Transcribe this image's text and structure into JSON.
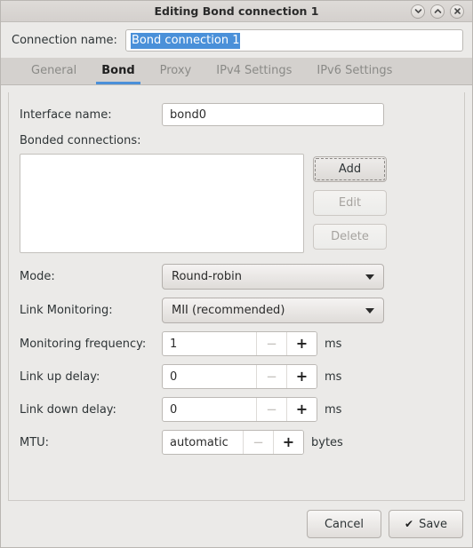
{
  "window": {
    "title": "Editing Bond connection 1",
    "controls": [
      {
        "name": "minimize",
        "glyph": "chevron-down"
      },
      {
        "name": "maximize",
        "glyph": "chevron-up"
      },
      {
        "name": "close",
        "glyph": "x"
      }
    ]
  },
  "connection": {
    "label": "Connection name:",
    "value": "Bond connection 1",
    "selected": true,
    "selection_color": "#4a90d9"
  },
  "tabs": [
    {
      "label": "General",
      "active": false
    },
    {
      "label": "Bond",
      "active": true
    },
    {
      "label": "Proxy",
      "active": false
    },
    {
      "label": "IPv4 Settings",
      "active": false
    },
    {
      "label": "IPv6 Settings",
      "active": false
    }
  ],
  "accent_color": "#4a90d9",
  "form": {
    "interface_name": {
      "label": "Interface name:",
      "value": "bond0"
    },
    "bonded_connections": {
      "label": "Bonded connections:",
      "items": [],
      "buttons": [
        {
          "label": "Add",
          "state": "focused"
        },
        {
          "label": "Edit",
          "state": "disabled"
        },
        {
          "label": "Delete",
          "state": "disabled"
        }
      ]
    },
    "mode": {
      "label": "Mode:",
      "value": "Round-robin"
    },
    "link_monitoring": {
      "label": "Link Monitoring:",
      "value": "MII (recommended)"
    },
    "monitoring_frequency": {
      "label": "Monitoring frequency:",
      "value": "1",
      "unit": "ms",
      "minus": "−",
      "plus": "+"
    },
    "link_up_delay": {
      "label": "Link up delay:",
      "value": "0",
      "unit": "ms",
      "minus": "−",
      "plus": "+"
    },
    "link_down_delay": {
      "label": "Link down delay:",
      "value": "0",
      "unit": "ms",
      "minus": "−",
      "plus": "+"
    },
    "mtu": {
      "label": "MTU:",
      "value": "automatic",
      "unit": "bytes",
      "minus": "−",
      "plus": "+"
    }
  },
  "footer": {
    "cancel_label": "Cancel",
    "save_label": "Save",
    "save_icon": "✔"
  }
}
